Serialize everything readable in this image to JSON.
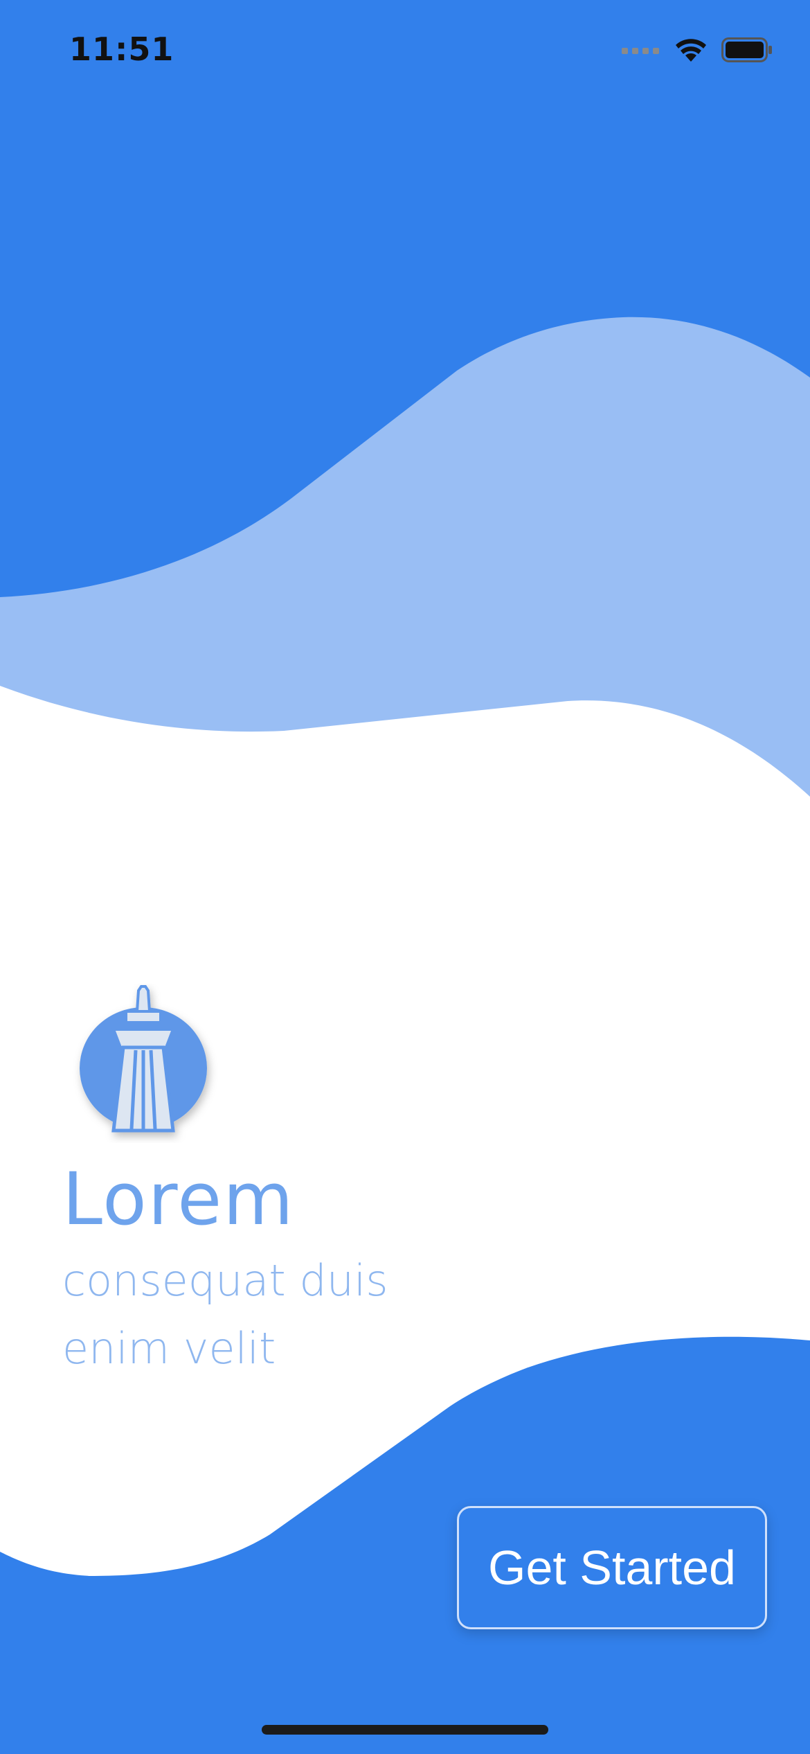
{
  "status_bar": {
    "time": "11:51"
  },
  "theme": {
    "primary": "#3280eb",
    "wave_light": "#99bef4",
    "text_accent": "#6ea3ec"
  },
  "brand": {
    "logo_icon": "lighthouse-icon",
    "title": "Lorem",
    "subtitle_line1": "consequat duis",
    "subtitle_line2": "enim velit"
  },
  "actions": {
    "get_started_label": "Get Started"
  }
}
